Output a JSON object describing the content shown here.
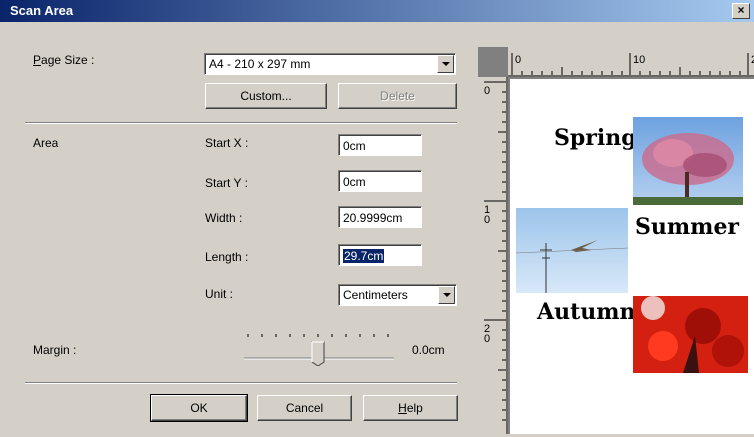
{
  "window": {
    "title": "Scan Area",
    "close_label": "×"
  },
  "page_size": {
    "label": "Page Size :",
    "value": "A4 - 210 x 297 mm"
  },
  "buttons": {
    "custom": "Custom...",
    "delete": "Delete",
    "ok": "OK",
    "cancel": "Cancel",
    "help": "Help"
  },
  "area": {
    "label": "Area",
    "start_x_label": "Start X :",
    "start_x": "0cm",
    "start_y_label": "Start Y :",
    "start_y": "0cm",
    "width_label": "Width :",
    "width": "20.9999cm",
    "length_label": "Length :",
    "length": "29.7cm",
    "unit_label": "Unit :",
    "unit": "Centimeters"
  },
  "margin": {
    "label": "Margin :",
    "value": "0.0cm",
    "slider_fraction": 0.5
  },
  "ruler": {
    "top_ticks": [
      "0",
      "10",
      "2"
    ],
    "left_ticks": [
      "0",
      "1\n0",
      "2\n0"
    ]
  },
  "preview": {
    "labels": [
      "Spring",
      "Summer",
      "Autumn"
    ]
  },
  "colors": {
    "title_start": "#0a246a",
    "title_end": "#a6caf0",
    "selection": "#0a246a"
  }
}
